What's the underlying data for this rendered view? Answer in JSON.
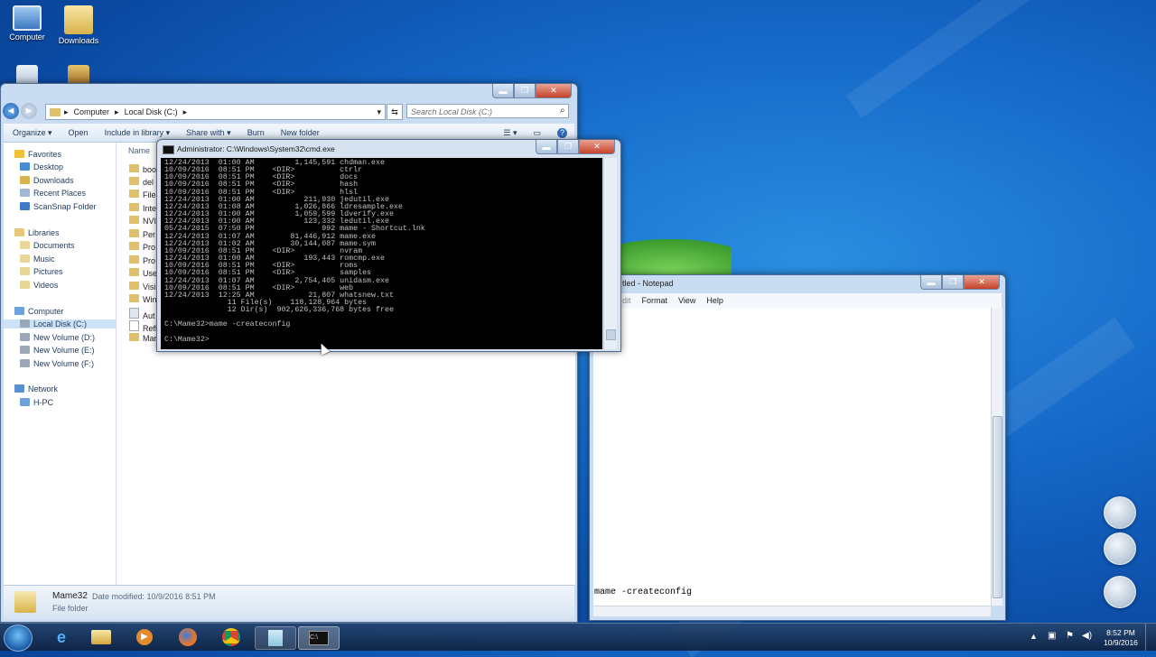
{
  "desktop": {
    "icons": [
      {
        "label": "Computer"
      },
      {
        "label": "Downloads"
      },
      {
        "label": ""
      },
      {
        "label": ""
      }
    ]
  },
  "explorer": {
    "address": {
      "crumbs": [
        "Computer",
        "Local Disk (C:)"
      ]
    },
    "search_placeholder": "Search Local Disk (C:)",
    "toolbar": [
      "Organize ▾",
      "Open",
      "Include in library ▾",
      "Share with ▾",
      "Burn",
      "New folder"
    ],
    "column_name": "Name",
    "nav": {
      "favorites_title": "Favorites",
      "favorites": [
        "Desktop",
        "Downloads",
        "Recent Places",
        "ScanSnap Folder"
      ],
      "libraries_title": "Libraries",
      "libraries": [
        "Documents",
        "Music",
        "Pictures",
        "Videos"
      ],
      "computer_title": "Computer",
      "drives": [
        "Local Disk (C:)",
        "New Volume (D:)",
        "New Volume (E:)",
        "New Volume (F:)"
      ],
      "network_title": "Network",
      "network": [
        "H-PC"
      ]
    },
    "files": [
      "boo",
      "del",
      "File",
      "Inte",
      "NVI",
      "Per",
      "Pro",
      "Pro",
      "Use",
      "Visi",
      "Win",
      "Aut",
      "Refl",
      "Mar"
    ],
    "details": {
      "name": "Mame32",
      "modified": "Date modified: 10/9/2016 8:51 PM",
      "type": "File folder"
    }
  },
  "cmd": {
    "title": "Administrator: C:\\Windows\\System32\\cmd.exe",
    "lines": [
      "12/24/2013  01:00 AM         1,145,591 chdman.exe",
      "10/09/2016  08:51 PM    <DIR>          ctrlr",
      "10/09/2016  08:51 PM    <DIR>          docs",
      "10/09/2016  08:51 PM    <DIR>          hash",
      "10/09/2016  08:51 PM    <DIR>          hlsl",
      "12/24/2013  01:00 AM           211,930 jedutil.exe",
      "12/24/2013  01:08 AM         1,026,866 ldresample.exe",
      "12/24/2013  01:00 AM         1,059,599 ldverify.exe",
      "12/24/2013  01:00 AM           123,332 ledutil.exe",
      "05/24/2015  07:50 PM               992 mame - Shortcut.lnk",
      "12/24/2013  01:07 AM        81,446,912 mame.exe",
      "12/24/2013  01:02 AM        30,144,087 mame.sym",
      "10/09/2016  08:51 PM    <DIR>          nvram",
      "12/24/2013  01:00 AM           193,443 romcmp.exe",
      "10/09/2016  08:51 PM    <DIR>          roms",
      "10/09/2016  08:51 PM    <DIR>          samples",
      "12/24/2013  01:07 AM         2,754,405 unidasm.exe",
      "10/09/2016  08:51 PM    <DIR>          web",
      "12/24/2013  12:25 AM            21,807 whatsnew.txt",
      "              11 File(s)    118,128,964 bytes",
      "              12 Dir(s)  902,626,336,768 bytes free",
      "",
      "C:\\Mame32>mame -createconfig",
      "",
      "C:\\Mame32>"
    ]
  },
  "notepad": {
    "title": "tled - Notepad",
    "menu": [
      "dit",
      "Format",
      "View",
      "Help"
    ],
    "content": "mame -createconfig"
  },
  "taskbar": {
    "time": "8:52 PM",
    "date": "10/9/2016"
  }
}
